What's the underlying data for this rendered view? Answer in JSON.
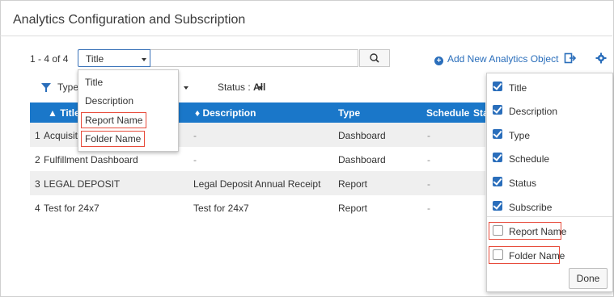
{
  "page": {
    "title": "Analytics Configuration and Subscription"
  },
  "toolbar": {
    "count": "1 - 4 of 4",
    "field_select": "Title",
    "search_value": "",
    "add_label": "Add New Analytics Object"
  },
  "filters": {
    "type_label": "Type",
    "status_label": "Status :",
    "status_value": "All"
  },
  "table": {
    "headers": [
      "▲ Title",
      "♦ Description",
      "Type",
      "Schedule",
      "Sta"
    ],
    "rows": [
      {
        "num": "1",
        "title": "Acquisiti",
        "description": "-",
        "type": "Dashboard",
        "schedule": "-"
      },
      {
        "num": "2",
        "title": "Fulfillment Dashboard",
        "description": "-",
        "type": "Dashboard",
        "schedule": "-"
      },
      {
        "num": "3",
        "title": "LEGAL DEPOSIT",
        "description": "Legal Deposit Annual Receipt",
        "type": "Report",
        "schedule": "-"
      },
      {
        "num": "4",
        "title": "Test for 24x7",
        "description": "Test for 24x7",
        "type": "Report",
        "schedule": "-"
      }
    ]
  },
  "field_dropdown": {
    "items": [
      "Title",
      "Description",
      "Report Name",
      "Folder Name"
    ]
  },
  "column_panel": {
    "items": [
      {
        "label": "Title",
        "checked": true
      },
      {
        "label": "Description",
        "checked": true
      },
      {
        "label": "Type",
        "checked": true
      },
      {
        "label": "Schedule",
        "checked": true
      },
      {
        "label": "Status",
        "checked": true
      },
      {
        "label": "Subscribe",
        "checked": true
      },
      {
        "label": "Report Name",
        "checked": false
      },
      {
        "label": "Folder Name",
        "checked": false
      }
    ],
    "done_label": "Done"
  },
  "colors": {
    "accent": "#1a77c9",
    "link": "#2a6ebb",
    "highlight": "#e74c3c"
  }
}
